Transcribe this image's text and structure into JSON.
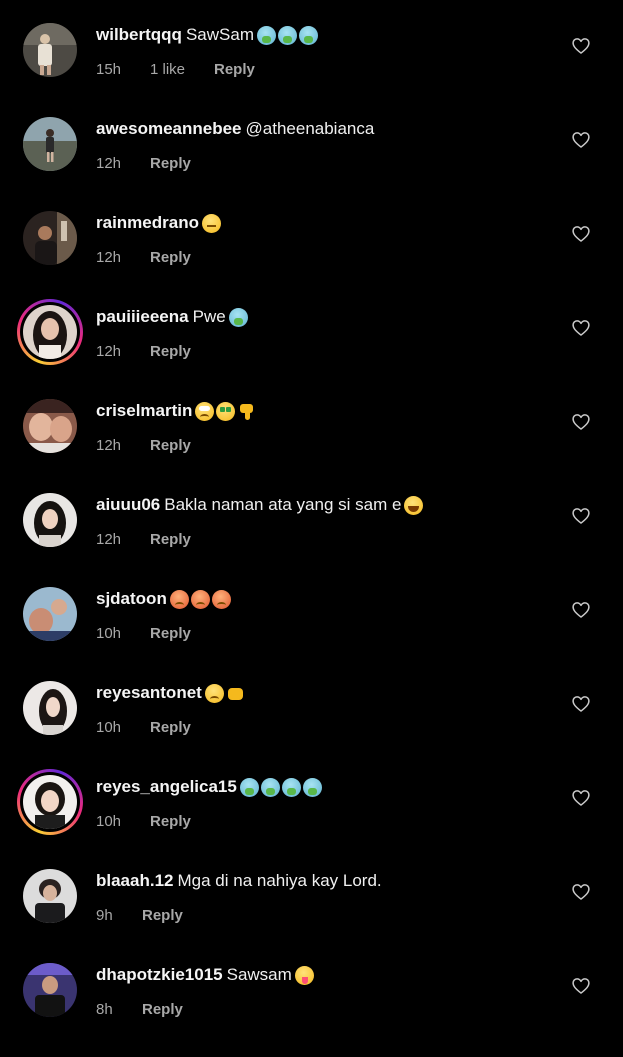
{
  "comments": [
    {
      "username": "wilbertqqq",
      "text": "SawSam",
      "emojis": [
        "vomit-emoji",
        "vomit-emoji",
        "vomit-emoji"
      ],
      "time": "15h",
      "likes": "1 like",
      "reply": "Reply",
      "story_ring": false
    },
    {
      "username": "awesomeannebee",
      "text": "@atheenabianca",
      "emojis": [],
      "time": "12h",
      "likes": "",
      "reply": "Reply",
      "story_ring": false
    },
    {
      "username": "rainmedrano",
      "text": "",
      "emojis": [
        "expressionless-emoji"
      ],
      "time": "12h",
      "likes": "",
      "reply": "Reply",
      "story_ring": false
    },
    {
      "username": "pauiiieeena",
      "text": "Pwe",
      "emojis": [
        "vomit-emoji"
      ],
      "time": "12h",
      "likes": "",
      "reply": "Reply",
      "story_ring": true
    },
    {
      "username": "criselmartin",
      "text": "",
      "emojis": [
        "eye-roll-emoji",
        "money-mouth-emoji",
        "thumbs-down-emoji"
      ],
      "time": "12h",
      "likes": "",
      "reply": "Reply",
      "story_ring": false
    },
    {
      "username": "aiuuu06",
      "text": "Bakla naman ata yang si sam e",
      "emojis": [
        "laughing-emoji"
      ],
      "time": "12h",
      "likes": "",
      "reply": "Reply",
      "story_ring": false
    },
    {
      "username": "sjdatoon",
      "text": "",
      "emojis": [
        "angry-emoji",
        "angry-emoji",
        "angry-emoji"
      ],
      "time": "10h",
      "likes": "",
      "reply": "Reply",
      "story_ring": false
    },
    {
      "username": "reyesantonet",
      "text": "",
      "emojis": [
        "confused-emoji",
        "fist-emoji"
      ],
      "time": "10h",
      "likes": "",
      "reply": "Reply",
      "story_ring": false
    },
    {
      "username": "reyes_angelica15",
      "text": "",
      "emojis": [
        "vomit-emoji",
        "vomit-emoji",
        "vomit-emoji",
        "vomit-emoji"
      ],
      "time": "10h",
      "likes": "",
      "reply": "Reply",
      "story_ring": true
    },
    {
      "username": "blaaah.12",
      "text": "Mga di na nahiya kay Lord.",
      "emojis": [],
      "time": "9h",
      "likes": "",
      "reply": "Reply",
      "story_ring": false
    },
    {
      "username": "dhapotzkie1015",
      "text": "Sawsam",
      "emojis": [
        "tongue-out-emoji"
      ],
      "time": "8h",
      "likes": "",
      "reply": "Reply",
      "story_ring": false
    }
  ],
  "icons": {
    "like": "heart-outline-icon"
  },
  "colors": {
    "background": "#000000",
    "username": "#f5f5f5",
    "meta": "#a8a8a8"
  }
}
